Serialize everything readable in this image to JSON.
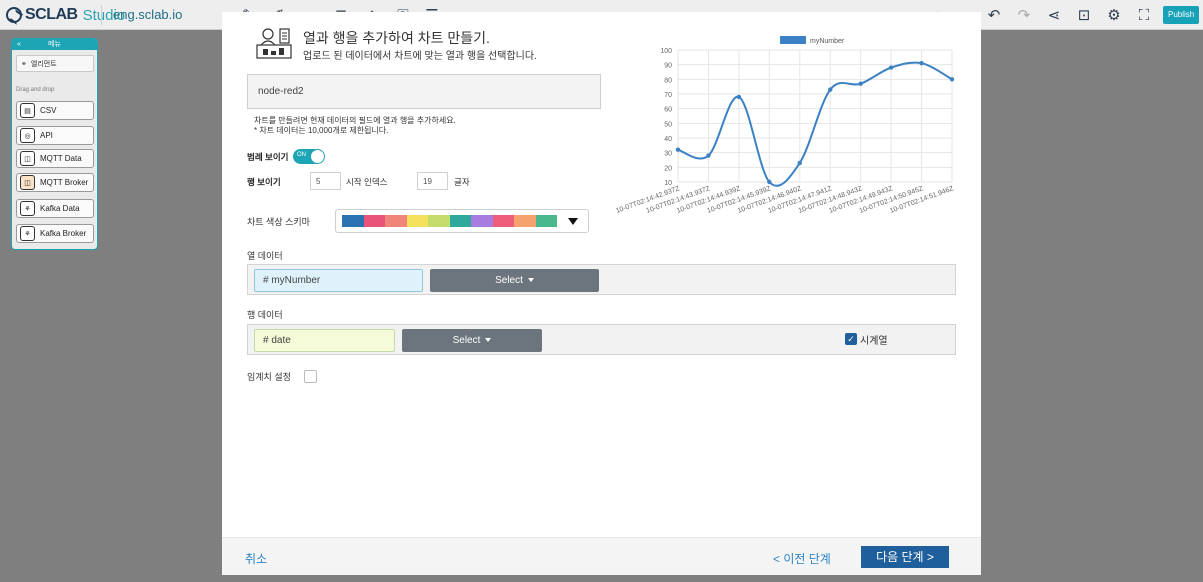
{
  "app": {
    "logo_text": "SCLAB",
    "logo_studio": "Studio",
    "domain": "eng.sclab.io",
    "publish_label": "Publish",
    "toolbar_icons": [
      "edit-icon",
      "edit-alt-icon",
      "brush-icon",
      "database-icon",
      "layers-icon",
      "key-icon",
      "list-icon",
      "save-icon",
      "home-icon",
      "search-icon",
      "undo-icon",
      "redo-icon",
      "share-icon",
      "lock-icon",
      "gear-icon",
      "fullscreen-icon"
    ]
  },
  "palette": {
    "header": "메뉴",
    "element_label": "엘리먼트",
    "dragdrop_label": "Drag and drop",
    "items": [
      {
        "label": "CSV",
        "icon": "csv"
      },
      {
        "label": "API",
        "icon": "api"
      },
      {
        "label": "MQTT Data",
        "icon": "mqtt"
      },
      {
        "label": "MQTT Broker",
        "icon": "mqtt-broker"
      },
      {
        "label": "Kafka Data",
        "icon": "kafka"
      },
      {
        "label": "Kafka Broker",
        "icon": "kafka-broker"
      }
    ]
  },
  "modal": {
    "title": "열과 행을 추가하여 차트 만들기.",
    "subtitle": "업로드 된 데이터에서 차트에 맞는 열과 행을 선택합니다.",
    "dataset_name": "node-red2",
    "hint_line1": "차트를 만들려면 현재 데이터의 필드에 열과 행을 추가하세요.",
    "hint_line2": "* 차트 데이터는 10,000개로 제한됩니다.",
    "legend_label": "범례 보이기",
    "legend_toggle": "ON",
    "rows_label": "행 보이기",
    "rows_value": "5",
    "start_index_label": "시작 인덱스",
    "start_index_value": "19",
    "chars_label": "글자",
    "color_scheme_label": "차트 색상 스키마",
    "color_scheme": [
      "#2c73b4",
      "#e9547a",
      "#f0867a",
      "#f6e15f",
      "#c5de6b",
      "#2ea99b",
      "#a77be0",
      "#ee5e7a",
      "#f6a26e",
      "#49b88c"
    ],
    "column_section_label": "열 데이터",
    "column_field": "# myNumber",
    "select_label": "Select",
    "row_section_label": "행 데이터",
    "row_field": "# date",
    "timeseries_label": "시계열",
    "timeseries_checked": true,
    "threshold_label": "임계치 설정",
    "threshold_checked": false,
    "cancel_label": "취소",
    "prev_label": "< 이전 단계",
    "next_label": "다음 단계 >"
  },
  "chart_data": {
    "type": "line",
    "series": [
      {
        "name": "myNumber",
        "color": "#3b82c4",
        "values": [
          32,
          28,
          68,
          10,
          23,
          73,
          77,
          88,
          91,
          80
        ]
      }
    ],
    "x": [
      "10-07T02:14:42.937Z",
      "10-07T02:14:43.937Z",
      "10-07T02:14:44.939Z",
      "10-07T02:14:45.939Z",
      "10-07T02:14:46.940Z",
      "10-07T02:14:47.941Z",
      "10-07T02:14:48.943Z",
      "10-07T02:14:49.943Z",
      "10-07T02:14:50.945Z",
      "10-07T02:14:51.946Z"
    ],
    "y_ticks": [
      10,
      20,
      30,
      40,
      50,
      60,
      70,
      80,
      90,
      100
    ],
    "ylim": [
      10,
      100
    ],
    "grid": true,
    "legend_position": "top"
  }
}
